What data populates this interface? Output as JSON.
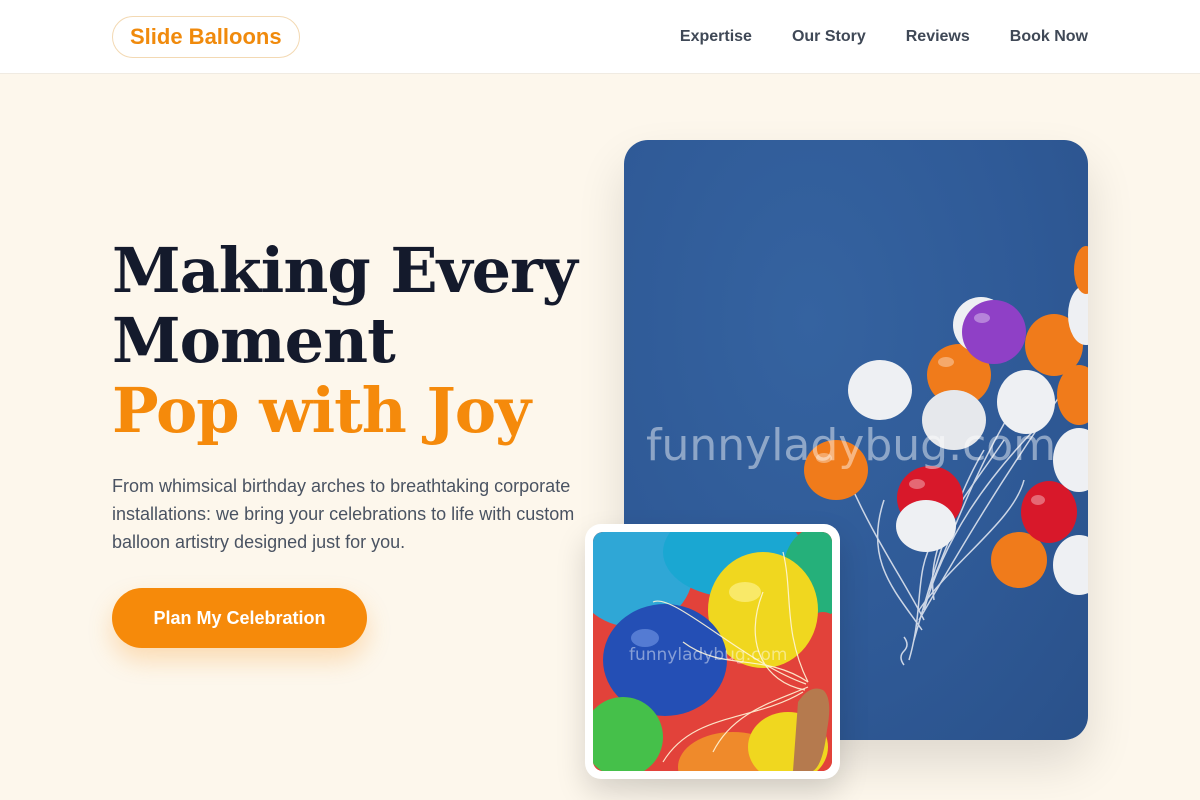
{
  "brand": {
    "name": "Slide Balloons",
    "accent_color": "#f58a0b"
  },
  "nav": {
    "items": [
      {
        "label": "Expertise"
      },
      {
        "label": "Our Story"
      },
      {
        "label": "Reviews"
      },
      {
        "label": "Book Now"
      }
    ]
  },
  "hero": {
    "title_line1": "Making Every",
    "title_line2": "Moment",
    "title_accent": "Pop with Joy",
    "description": "From whimsical birthday arches to breathtaking corporate installations: we bring your celebrations to life with custom balloon artistry designed just for you.",
    "cta_label": "Plan My Celebration"
  },
  "images": {
    "main_watermark": "funnyladybug.com",
    "small_watermark": "funnyladybug.com"
  }
}
